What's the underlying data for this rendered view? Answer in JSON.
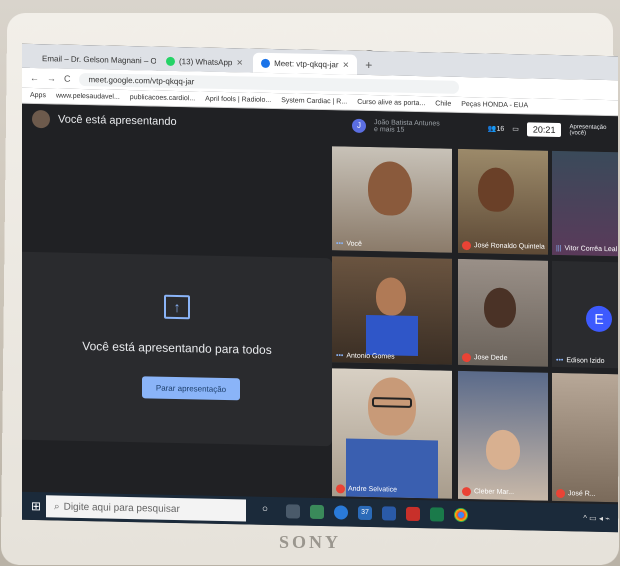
{
  "device": {
    "brand": "SONY"
  },
  "browser": {
    "tabs": [
      {
        "label": "Email – Dr. Gelson Magnani – Ou",
        "color": "#5b6ee1"
      },
      {
        "label": "(13) WhatsApp",
        "color": "#25d366"
      },
      {
        "label": "Meet: vtp-qkqq-jar",
        "color": "#1a73e8"
      }
    ],
    "url": "meet.google.com/vtp-qkqq-jar",
    "bookmarks": [
      "Apps",
      "www.pelesaudavel...",
      "publicacoes.cardiol...",
      "April fools | Radiolo...",
      "System Cardiac | R...",
      "Curso alive as porta...",
      "Chile",
      "Peças HONDA - EUA"
    ]
  },
  "meet": {
    "presenting_label": "Você está apresentando",
    "panel_message": "Você está apresentando para todos",
    "stop_button": "Parar apresentação",
    "participants_badge": "J",
    "participants_text": "João Batista Antunes\ne mais 15",
    "clock": "20:21",
    "count": "16",
    "presentation_label": "Apresentação (você)",
    "tiles": [
      {
        "name": "Você",
        "muted": false
      },
      {
        "name": "José Ronaldo Quintela",
        "muted": true
      },
      {
        "name": "Vitor Corrêa Leal",
        "muted": false
      },
      {
        "name": "Antonio Gomes",
        "muted": false
      },
      {
        "name": "Jose Dede",
        "muted": true
      },
      {
        "name": "Edison Izido",
        "muted": false
      },
      {
        "name": "Andre Selvatice",
        "muted": true
      },
      {
        "name": "Cleber Mar...",
        "muted": true
      },
      {
        "name": "José R...",
        "muted": true
      }
    ],
    "e_badge": "E"
  },
  "taskbar": {
    "search_placeholder": "Digite aqui para pesquisar",
    "notification_count": "37"
  }
}
